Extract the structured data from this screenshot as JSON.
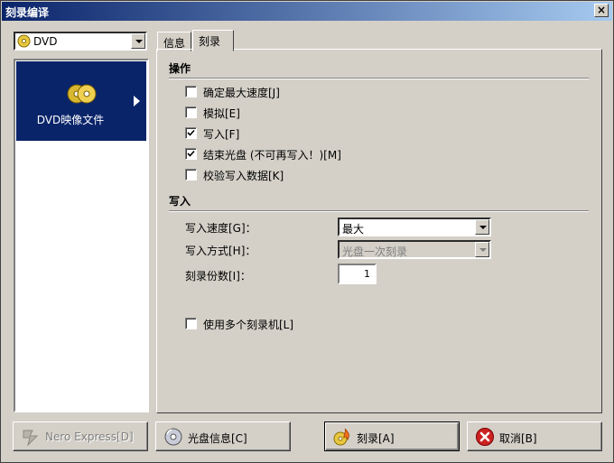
{
  "window": {
    "title": "刻录编译",
    "close_glyph": "×"
  },
  "type_combo": {
    "value": "DVD",
    "icon": "dvd-disc-icon"
  },
  "left_list": {
    "items": [
      {
        "label": "DVD映像文件",
        "icon": "dvd-discs-icon",
        "selected": true
      }
    ]
  },
  "tabs": [
    {
      "label": "信息"
    },
    {
      "label": "刻录",
      "active": true
    }
  ],
  "operations": {
    "title": "操作",
    "items": [
      {
        "label": "确定最大速度[J]",
        "checked": false
      },
      {
        "label": "模拟[E]",
        "checked": false
      },
      {
        "label": "写入[F]",
        "checked": true
      },
      {
        "label": "结束光盘 (不可再写入！)[M]",
        "checked": true
      },
      {
        "label": "校验写入数据[K]",
        "checked": false
      }
    ]
  },
  "write": {
    "title": "写入",
    "speed_label": "写入速度[G]：",
    "speed_value": "最大",
    "method_label": "写入方式[H]：",
    "method_value": "光盘一次刻录",
    "copies_label": "刻录份数[I]：",
    "copies_value": "1",
    "multi_label": "使用多个刻录机[L]"
  },
  "buttons": {
    "nero_express": "Nero Express[D]",
    "disc_info": "光盘信息[C]",
    "burn": "刻录[A]",
    "cancel": "取消[B]"
  },
  "colors": {
    "selection": "#0a246a",
    "face": "#d4d0c8",
    "cancel_red": "#cc2222"
  }
}
